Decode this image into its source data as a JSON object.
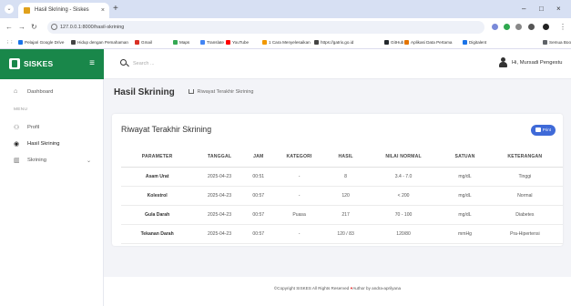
{
  "browser": {
    "tab_title": "Hasil Skrining - Siskes",
    "tab_close": "×",
    "new_tab": "+",
    "url": "127.0.0.1:8000/hasil-skrining",
    "window_controls": [
      "⌄",
      "–",
      "□",
      "×"
    ],
    "bookmarks": [
      {
        "label": "Pelajari Google Drive",
        "color": "#1a73e8"
      },
      {
        "label": "Hidup dengan Pemahaman",
        "color": "#444444"
      },
      {
        "label": "Gmail",
        "color": "#d93025"
      },
      {
        "label": "Maps",
        "color": "#34a853"
      },
      {
        "label": "Translate",
        "color": "#4285f4"
      },
      {
        "label": "YouTube",
        "color": "#ff0000"
      },
      {
        "label": "1 Cara Menyelesaikan",
        "color": "#f29900"
      },
      {
        "label": "https://gatrix.go.id",
        "color": "#444444"
      },
      {
        "label": "GitHub",
        "color": "#24292e"
      },
      {
        "label": "Aplikasi Data Pertama",
        "color": "#e37400"
      },
      {
        "label": "Digitalent",
        "color": "#1a73e8"
      },
      {
        "label": "Semua Bookmark",
        "color": "#5f6368"
      }
    ]
  },
  "sidebar": {
    "brand": "SISKES",
    "items": [
      {
        "label": "Dashboard",
        "icon": "home-icon"
      },
      {
        "label": "Profil",
        "icon": "users-icon"
      },
      {
        "label": "Hasil Skrining",
        "icon": "dot-circle-icon"
      },
      {
        "label": "Skrining",
        "icon": "building-icon"
      }
    ],
    "section_label": "MENU"
  },
  "topbar": {
    "search_placeholder": "Search ...",
    "user_name": "Hi, Mursadi Pengestu"
  },
  "page": {
    "title": "Hasil Skrining",
    "breadcrumb": "Riwayat Terakhir Skrining"
  },
  "card": {
    "title": "Riwayat Terakhir Skrining",
    "print_label": "Print",
    "columns": [
      "PARAMETER",
      "TANGGAL",
      "JAM",
      "KATEGORI",
      "HASIL",
      "NILAI NORMAL",
      "SATUAN",
      "KETERANGAN"
    ],
    "rows": [
      [
        "Asam Urat",
        "2025-04-23",
        "00:51",
        "-",
        "8",
        "3.4 - 7.0",
        "mg/dL",
        "Tinggi"
      ],
      [
        "Kolestrol",
        "2025-04-23",
        "00:57",
        "-",
        "120",
        "< 200",
        "mg/dL",
        "Normal"
      ],
      [
        "Gula Darah",
        "2025-04-23",
        "00:57",
        "Puasa",
        "217",
        "70 - 100",
        "mg/dL",
        "Diabetes"
      ],
      [
        "Tekanan Darah",
        "2025-04-23",
        "00:57",
        "-",
        "120 / 83",
        "120/80",
        "mmHg",
        "Pra-Hipertensi"
      ]
    ]
  },
  "footer": {
    "prefix": "©Copyright SISKES All Rights Reserved",
    "heart": "♥",
    "suffix": "Author by andra-aprilyana"
  }
}
